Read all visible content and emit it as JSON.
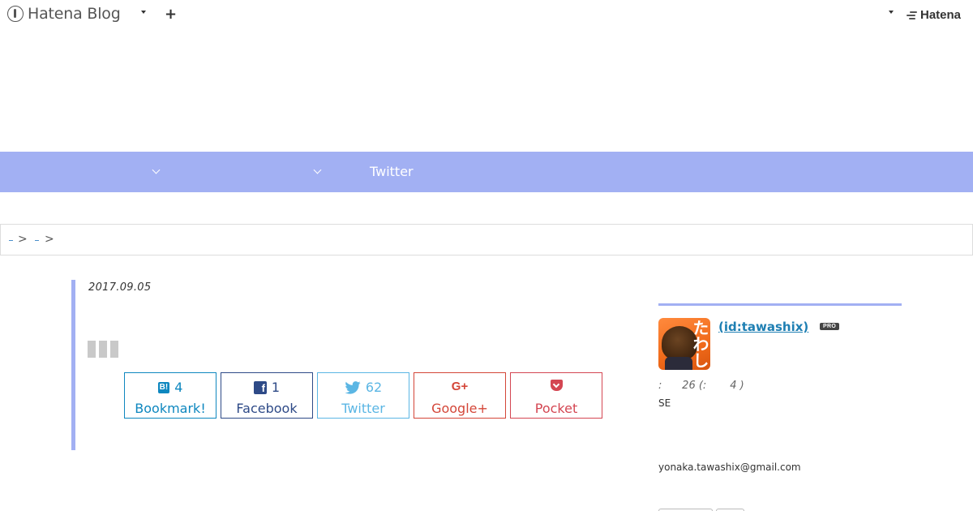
{
  "header": {
    "logo_text": "Hatena Blog",
    "plus_label": "+",
    "hatena_text": "Hatena"
  },
  "nav": {
    "twitter_label": "Twitter"
  },
  "breadcrumb": {
    "separator": ">"
  },
  "article": {
    "date": "2017.09.05"
  },
  "share": {
    "bookmark": {
      "count": "4",
      "label": "Bookmark!",
      "icon": "B!"
    },
    "facebook": {
      "count": "1",
      "label": "Facebook",
      "icon": "f"
    },
    "twitter": {
      "count": "62",
      "label": "Twitter"
    },
    "google": {
      "label": "Google+",
      "icon": "G+"
    },
    "pocket": {
      "label": "Pocket"
    }
  },
  "sidebar": {
    "profile_name": " (id:tawashix)",
    "pro_badge": "PRO",
    "avatar_text": "たわし",
    "meta": ":      26 (:       4 )",
    "bio": "SE",
    "email": "yonaka.tawashix@gmail.com"
  },
  "colors": {
    "accent": "#a2b0f3",
    "bookmark": "#0e87bf",
    "facebook": "#2e4a87",
    "twitter": "#5bb6e4",
    "google": "#d44638",
    "pocket": "#d44652"
  }
}
